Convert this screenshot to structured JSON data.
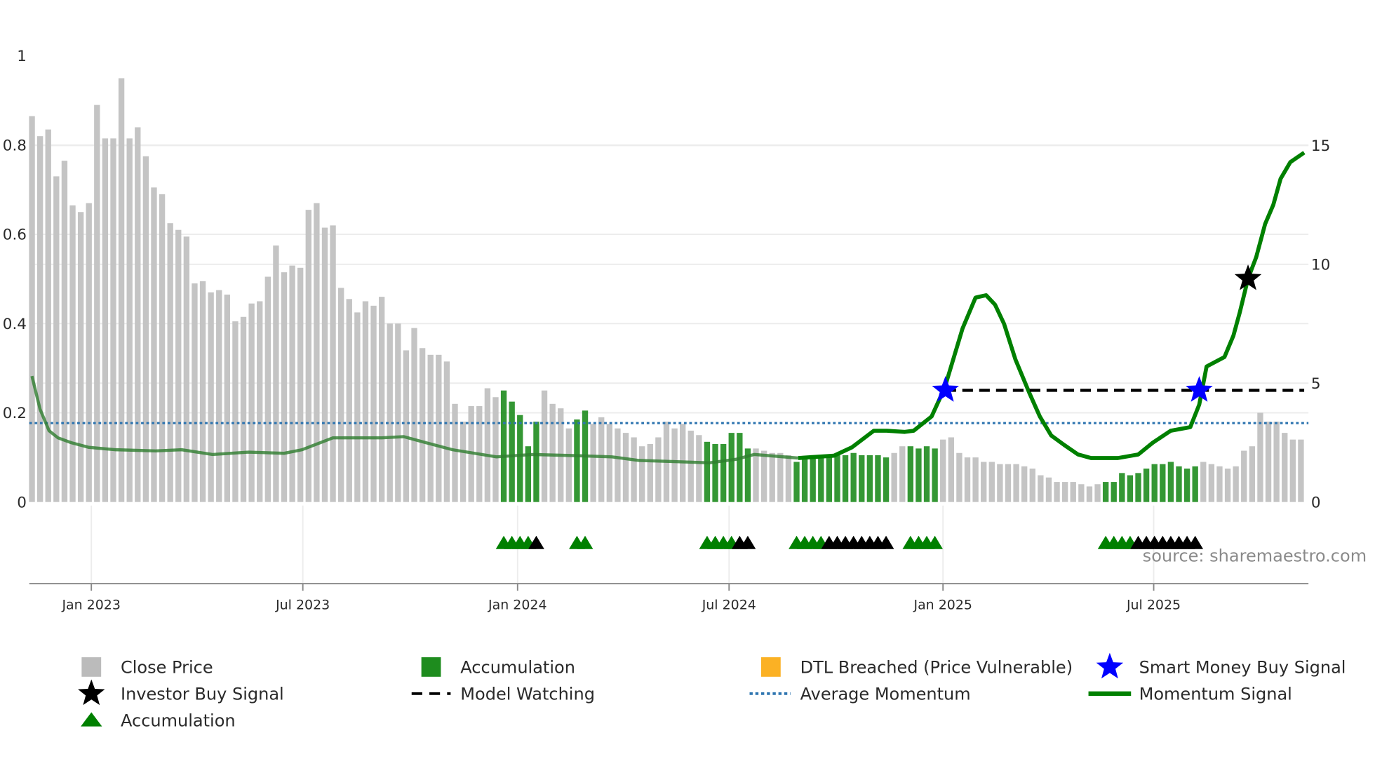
{
  "chart_data": {
    "type": "bar+line",
    "x_unit": "week index",
    "left_axis": {
      "ylim": [
        0,
        1
      ],
      "ticks": [
        0,
        0.2,
        0.4,
        0.6,
        0.8,
        1
      ],
      "tick_labels": [
        "0",
        "0.2",
        "0.4",
        "0.6",
        "0.8",
        "1"
      ]
    },
    "right_axis": {
      "ylim": [
        0,
        18.8
      ],
      "ticks": [
        0,
        5,
        10,
        15
      ],
      "tick_labels": [
        "0",
        "5",
        "10",
        "15"
      ]
    },
    "x_ticks": [
      {
        "label": "Jan 2023",
        "index": 7.3
      },
      {
        "label": "Jul 2023",
        "index": 33.3
      },
      {
        "label": "Jan 2024",
        "index": 59.7
      },
      {
        "label": "Jul 2024",
        "index": 85.7
      },
      {
        "label": "Jan 2025",
        "index": 112
      },
      {
        "label": "Jul 2025",
        "index": 137.9
      }
    ],
    "close_price": [
      0.865,
      0.82,
      0.835,
      0.73,
      0.765,
      0.665,
      0.65,
      0.67,
      0.89,
      0.815,
      0.815,
      0.95,
      0.815,
      0.84,
      0.775,
      0.705,
      0.69,
      0.625,
      0.61,
      0.595,
      0.49,
      0.495,
      0.47,
      0.475,
      0.465,
      0.405,
      0.415,
      0.445,
      0.45,
      0.505,
      0.575,
      0.515,
      0.53,
      0.525,
      0.655,
      0.67,
      0.615,
      0.62,
      0.48,
      0.455,
      0.425,
      0.45,
      0.44,
      0.46,
      0.4,
      0.4,
      0.34,
      0.39,
      0.345,
      0.33,
      0.33,
      0.315,
      0.22,
      0.18,
      0.215,
      0.215,
      0.255,
      0.235,
      0.25,
      0.225,
      0.195,
      0.125,
      0.18,
      0.25,
      0.22,
      0.21,
      0.165,
      0.185,
      0.205,
      0.175,
      0.19,
      0.175,
      0.165,
      0.155,
      0.145,
      0.125,
      0.13,
      0.145,
      0.18,
      0.165,
      0.175,
      0.16,
      0.15,
      0.135,
      0.13,
      0.13,
      0.155,
      0.155,
      0.12,
      0.12,
      0.115,
      0.11,
      0.11,
      0.105,
      0.09,
      0.1,
      0.105,
      0.105,
      0.105,
      0.105,
      0.105,
      0.11,
      0.105,
      0.105,
      0.105,
      0.1,
      0.11,
      0.125,
      0.125,
      0.12,
      0.125,
      0.12,
      0.14,
      0.145,
      0.11,
      0.1,
      0.1,
      0.09,
      0.09,
      0.085,
      0.085,
      0.085,
      0.08,
      0.075,
      0.06,
      0.055,
      0.045,
      0.045,
      0.045,
      0.04,
      0.035,
      0.04,
      0.045,
      0.045,
      0.065,
      0.06,
      0.065,
      0.075,
      0.085,
      0.085,
      0.09,
      0.08,
      0.075,
      0.08,
      0.09,
      0.085,
      0.08,
      0.075,
      0.08,
      0.115,
      0.125,
      0.2,
      0.18,
      0.18,
      0.155,
      0.14,
      0.14
    ],
    "accumulation_bars": [
      58,
      59,
      60,
      61,
      62,
      67,
      68,
      83,
      84,
      85,
      86,
      87,
      88,
      94,
      95,
      96,
      97,
      98,
      99,
      100,
      101,
      102,
      103,
      104,
      105,
      108,
      109,
      110,
      111,
      132,
      133,
      134,
      135,
      136,
      137,
      138,
      139,
      140,
      141,
      142,
      143
    ],
    "momentum_signal": [
      [
        0,
        5.3
      ],
      [
        1,
        3.9
      ],
      [
        2.1,
        3.0
      ],
      [
        3.2,
        2.7
      ],
      [
        4.8,
        2.5
      ],
      [
        7,
        2.3
      ],
      [
        10.3,
        2.2
      ],
      [
        15.2,
        2.15
      ],
      [
        18.4,
        2.2
      ],
      [
        22.2,
        2.0
      ],
      [
        26.6,
        2.1
      ],
      [
        31,
        2.05
      ],
      [
        33.2,
        2.2
      ],
      [
        37,
        2.7
      ],
      [
        39.7,
        2.7
      ],
      [
        43,
        2.7
      ],
      [
        45.7,
        2.75
      ],
      [
        48.4,
        2.5
      ],
      [
        51.7,
        2.2
      ],
      [
        57.1,
        1.9
      ],
      [
        61.5,
        2.0
      ],
      [
        67,
        1.95
      ],
      [
        71.3,
        1.9
      ],
      [
        74.6,
        1.75
      ],
      [
        79,
        1.7
      ],
      [
        83.3,
        1.65
      ],
      [
        86.6,
        1.8
      ],
      [
        88.8,
        2.0
      ],
      [
        94.2,
        1.85
      ],
      [
        98.6,
        1.95
      ],
      [
        100.8,
        2.3
      ],
      [
        103.5,
        3.0
      ],
      [
        105.1,
        3.0
      ],
      [
        107.3,
        2.95
      ],
      [
        108.4,
        3.0
      ],
      [
        110.6,
        3.6
      ],
      [
        112.2,
        4.8
      ],
      [
        114.4,
        7.3
      ],
      [
        116,
        8.6
      ],
      [
        117.3,
        8.7
      ],
      [
        118.4,
        8.3
      ],
      [
        119.5,
        7.5
      ],
      [
        120.9,
        6.0
      ],
      [
        122.6,
        4.6
      ],
      [
        123.9,
        3.6
      ],
      [
        125.3,
        2.8
      ],
      [
        126.9,
        2.4
      ],
      [
        128.6,
        2.0
      ],
      [
        130.2,
        1.85
      ],
      [
        133.5,
        1.85
      ],
      [
        136,
        2.0
      ],
      [
        137.8,
        2.5
      ],
      [
        140,
        3.0
      ],
      [
        142.4,
        3.15
      ],
      [
        143.5,
        4.1
      ],
      [
        144.4,
        5.7
      ],
      [
        146.6,
        6.1
      ],
      [
        147.7,
        7.0
      ],
      [
        148.5,
        8.0
      ],
      [
        149.5,
        9.4
      ],
      [
        150.5,
        10.3
      ],
      [
        151.6,
        11.7
      ],
      [
        152.6,
        12.5
      ],
      [
        153.5,
        13.6
      ],
      [
        154.7,
        14.3
      ],
      [
        156.4,
        14.7
      ]
    ],
    "average_momentum": 3.32,
    "model_watching": {
      "from": 112.3,
      "to": 156.4,
      "value": 4.7
    },
    "smart_money_buy_signals": [
      [
        112.3,
        4.7
      ],
      [
        143.5,
        4.7
      ]
    ],
    "investor_buy_signals": [
      [
        149.5,
        9.4
      ]
    ],
    "accumulation_markers_green": [
      58,
      59,
      60,
      61,
      67,
      68,
      83,
      84,
      85,
      86,
      94,
      95,
      96,
      97,
      108,
      109,
      110,
      111,
      132,
      133,
      134,
      135
    ],
    "accumulation_markers_black": [
      62,
      87,
      88,
      98,
      99,
      100,
      101,
      102,
      103,
      104,
      105,
      136,
      137,
      138,
      139,
      140,
      141,
      142,
      143
    ],
    "source": "source: sharemaestro.com",
    "legend": [
      {
        "label": "Close Price",
        "icon": "gray-square",
        "color": "#bbbbbb"
      },
      {
        "label": "Accumulation",
        "icon": "green-square",
        "color": "#1e8c1e"
      },
      {
        "label": "DTL Breached (Price Vulnerable)",
        "icon": "orange-square",
        "color": "#fbb124"
      },
      {
        "label": "Smart Money Buy Signal",
        "icon": "blue-star",
        "color": "#0000ff"
      },
      {
        "label": "Investor Buy Signal",
        "icon": "black-star",
        "color": "#000000"
      },
      {
        "label": "Model Watching",
        "icon": "black-dashed-line",
        "color": "#000000"
      },
      {
        "label": "Average Momentum",
        "icon": "blue-dotted-line",
        "color": "#2e75b0"
      },
      {
        "label": "Momentum Signal",
        "icon": "green-line",
        "color": "#008000"
      },
      {
        "label": "Accumulation",
        "icon": "green-triangle",
        "color": "#008000"
      }
    ],
    "legend_placement": "bottom"
  }
}
